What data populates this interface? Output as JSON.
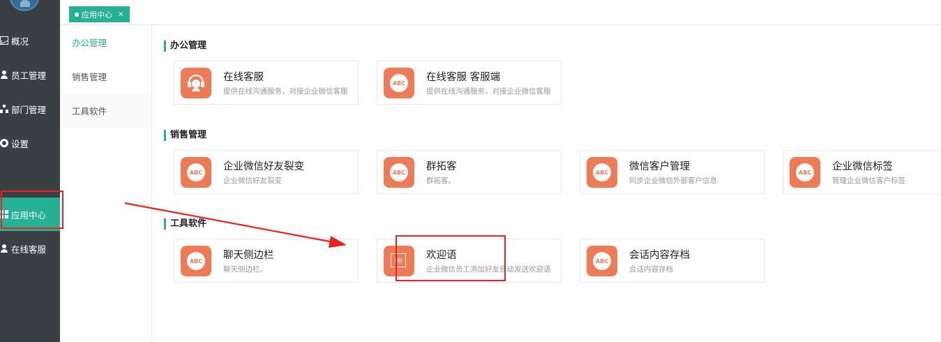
{
  "sidebar": {
    "items": [
      {
        "label": "概况",
        "icon": "chart-icon"
      },
      {
        "label": "员工管理",
        "icon": "user-icon"
      },
      {
        "label": "部门管理",
        "icon": "org-icon"
      },
      {
        "label": "设置",
        "icon": "gear-icon"
      },
      {
        "label": "应用中心",
        "icon": "grid-icon",
        "active": true
      },
      {
        "label": "在线客服",
        "icon": "user-icon"
      }
    ]
  },
  "tabbar": {
    "tab_label": "应用中心",
    "close": "×"
  },
  "submenu": {
    "items": [
      {
        "label": "办公管理",
        "active": true
      },
      {
        "label": "销售管理"
      },
      {
        "label": "工具软件"
      }
    ]
  },
  "sections": [
    {
      "title": "办公管理",
      "cards": [
        {
          "name": "在线客服",
          "desc": "提供在线沟通服务，对接企业微信客服",
          "icon": "headset-icon"
        },
        {
          "name": "在线客服 客服端",
          "desc": "提供在线沟通服务，对接企业微信客服",
          "icon": "abc-icon",
          "badge": "ABC"
        }
      ]
    },
    {
      "title": "销售管理",
      "cards": [
        {
          "name": "企业微信好友裂变",
          "desc": "企业微信好友裂变",
          "icon": "abc-icon",
          "badge": "ABC"
        },
        {
          "name": "群拓客",
          "desc": "群拓客。",
          "icon": "abc-icon",
          "badge": "ABC"
        },
        {
          "name": "微信客户管理",
          "desc": "同步企业微信外部客户信息",
          "icon": "abc-icon",
          "badge": "ABC"
        },
        {
          "name": "企业微信标签",
          "desc": "管理企业微信客户标签",
          "icon": "abc-icon",
          "badge": "ABC"
        }
      ]
    },
    {
      "title": "工具软件",
      "cards": [
        {
          "name": "聊天侧边栏",
          "desc": "聊天侧边栏。",
          "icon": "abc-icon",
          "badge": "ABC"
        },
        {
          "name": "欢迎语",
          "desc": "企业微信员工添加好友自动发送欢迎语",
          "icon": "hi-icon",
          "badge": "Hi"
        },
        {
          "name": "会话内容存档",
          "desc": "会话内容存档",
          "icon": "abc-icon",
          "badge": "ABC"
        }
      ]
    }
  ],
  "colors": {
    "accent": "#26b194",
    "sidebar_bg": "#3a3f44",
    "app_icon": "#ee7a56",
    "annotation": "#ee1f1f"
  }
}
